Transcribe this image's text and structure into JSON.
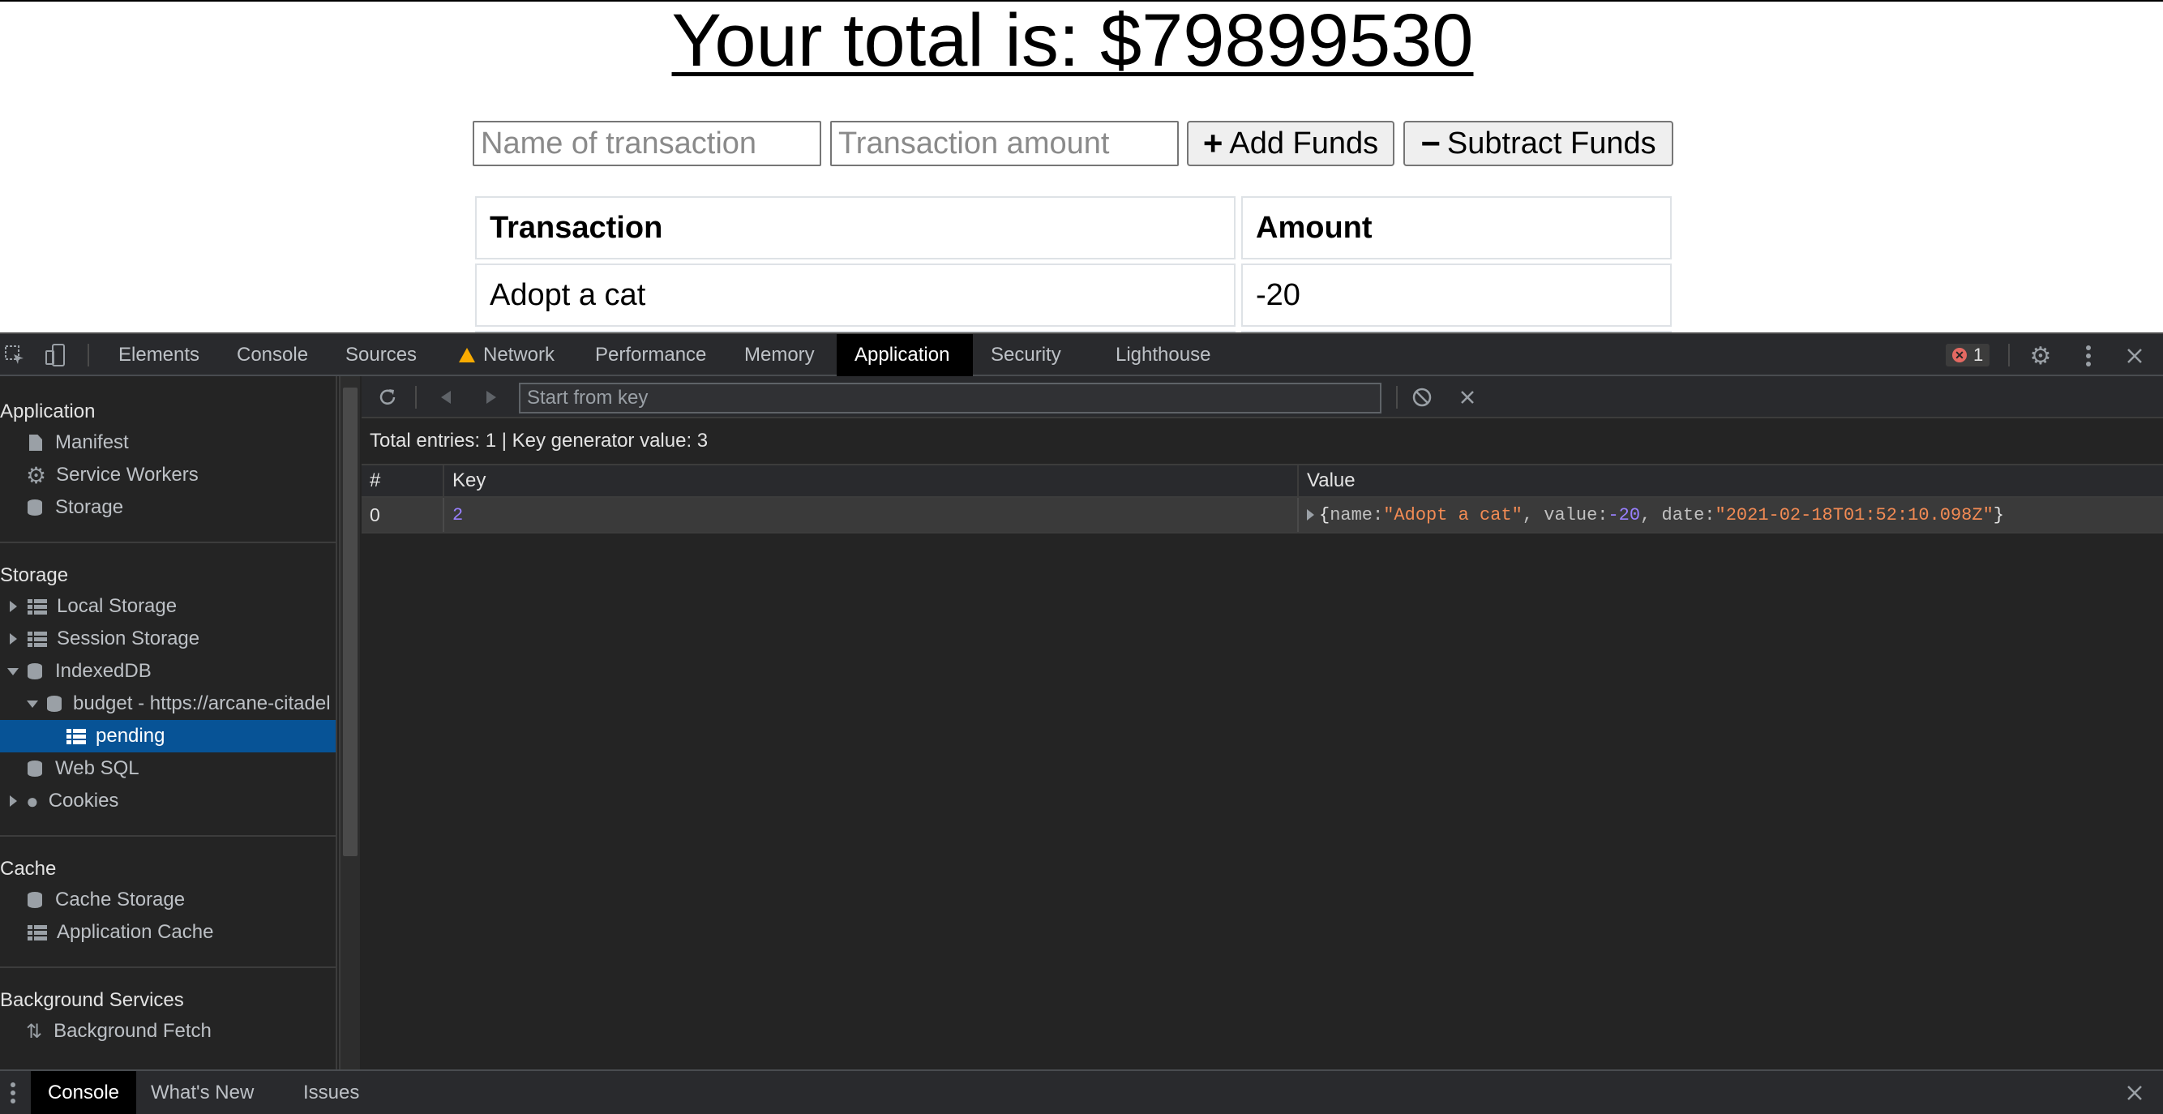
{
  "app": {
    "total_label": "Your total is: $79899530",
    "name_placeholder": "Name of transaction",
    "amount_placeholder": "Transaction amount",
    "add_button": "Add Funds",
    "add_symbol": "+",
    "subtract_button": "Subtract Funds",
    "subtract_symbol": "−",
    "table": {
      "headers": [
        "Transaction",
        "Amount"
      ],
      "rows": [
        [
          "Adopt a cat",
          "-20"
        ]
      ]
    }
  },
  "devtools": {
    "tabs": [
      "Elements",
      "Console",
      "Sources",
      "Network",
      "Performance",
      "Memory",
      "Application",
      "Security",
      "Lighthouse"
    ],
    "active_tab": "Application",
    "error_count": "1",
    "sidebar": {
      "application_header": "Application",
      "application_items": [
        "Manifest",
        "Service Workers",
        "Storage"
      ],
      "storage_header": "Storage",
      "storage_items": [
        "Local Storage",
        "Session Storage",
        "IndexedDB",
        "budget - https://arcane-citadel",
        "pending",
        "Web SQL",
        "Cookies"
      ],
      "cache_header": "Cache",
      "cache_items": [
        "Cache Storage",
        "Application Cache"
      ],
      "background_header": "Background Services",
      "background_items": [
        "Background Fetch"
      ]
    },
    "toolbar": {
      "start_key_placeholder": "Start from key"
    },
    "summary": "Total entries: 1 | Key generator value: 3",
    "grid": {
      "headers": [
        "#",
        "Key",
        "Value"
      ],
      "rows": [
        {
          "index": "0",
          "key": "2",
          "value_open": "{",
          "name_prop": "name: ",
          "name_val": "\"Adopt a cat\"",
          "value_prop": ", value: ",
          "value_val": "-20",
          "date_prop": ", date: ",
          "date_val": "\"2021-02-18T01:52:10.098Z\"",
          "value_close": "}"
        }
      ]
    },
    "drawer_tabs": [
      "Console",
      "What's New",
      "Issues"
    ],
    "drawer_active": "Console"
  }
}
